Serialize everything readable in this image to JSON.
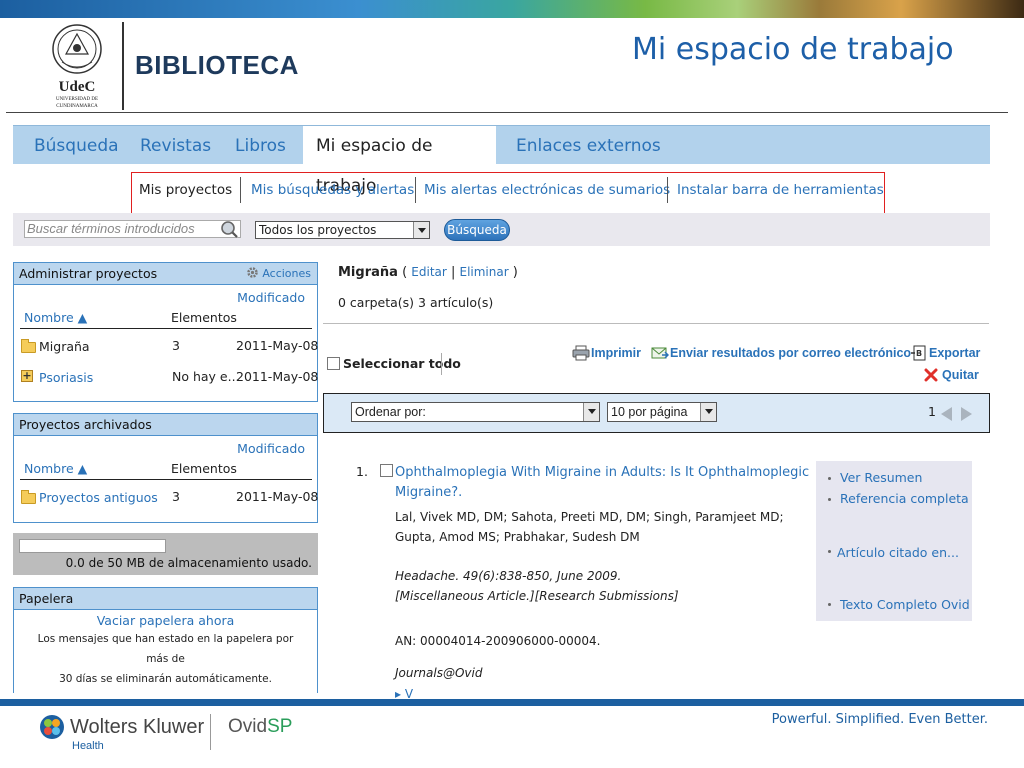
{
  "header": {
    "logo_text": "UdeC",
    "logo_subtext": "UNIVERSIDAD DE CUNDINAMARCA",
    "library_label": "BIBLIOTECA",
    "slide_title": "Mi espacio de trabajo"
  },
  "tabs": [
    {
      "label": "Búsqueda",
      "active": false
    },
    {
      "label": "Revistas",
      "active": false
    },
    {
      "label": "Libros",
      "active": false
    },
    {
      "label": "Mi espacio de trabajo",
      "active": true
    },
    {
      "label": "Enlaces externos",
      "active": false
    }
  ],
  "subnav": [
    {
      "label": "Mis proyectos",
      "active": true
    },
    {
      "label": "Mis búsquedas y alertas",
      "active": false
    },
    {
      "label": "Mis alertas electrónicas de sumarios",
      "active": false
    },
    {
      "label": "Instalar barra de herramientas",
      "active": false
    }
  ],
  "search": {
    "placeholder": "Buscar términos introducidos",
    "scope_value": "Todos los proyectos",
    "button_label": "Búsqueda"
  },
  "manage_panel": {
    "title": "Administrar proyectos",
    "actions_label": "Acciones",
    "modified_header": "Modificado",
    "name_header": "Nombre ▲",
    "items_header": "Elementos",
    "rows": [
      {
        "name": "Migraña",
        "items": "3",
        "modified": "2011-May-08",
        "icon": "folder-icon"
      },
      {
        "name": "Psoriasis",
        "items": "No hay e...",
        "modified": "2011-May-08",
        "icon": "plus-folder-icon"
      }
    ]
  },
  "archived_panel": {
    "title": "Proyectos archivados",
    "modified_header": "Modificado",
    "name_header": "Nombre ▲",
    "items_header": "Elementos",
    "rows": [
      {
        "name": "Proyectos antiguos",
        "items": "3",
        "modified": "2011-May-08",
        "icon": "folder-icon"
      }
    ]
  },
  "storage": {
    "text": "0.0 de 50 MB de almacenamiento usado.",
    "used_fraction": 0.0
  },
  "trash_panel": {
    "title": "Papelera",
    "empty_link": "Vaciar papelera ahora",
    "note_1": "Los mensajes que han estado en la papelera por",
    "note_2": "más de",
    "note_3": "30 días se eliminarán automáticamente."
  },
  "project": {
    "name": "Migraña",
    "open_paren": "(",
    "edit": "Editar",
    "sep": "|",
    "delete": "Eliminar",
    "close_paren": ")",
    "counts": "0 carpeta(s) 3 artículo(s)"
  },
  "toolbar": {
    "select_all": "Seleccionar todo",
    "print": "Imprimir",
    "email": "Enviar resultados por correo electrónico",
    "export": "Exportar",
    "remove": "Quitar"
  },
  "sortbar": {
    "sort_value": "Ordenar por:",
    "per_page_value": "10 por página",
    "page": "1"
  },
  "result": {
    "number": "1.",
    "title": "Ophthalmoplegia With Migraine in Adults: Is It Ophthalmoplegic Migraine?.",
    "authors": "Lal, Vivek MD, DM; Sahota, Preeti MD, DM; Singh, Paramjeet MD; Gupta, Amod MS; Prabhakar, Sudesh DM",
    "citation": "Headache. 49(6):838-850, June 2009.",
    "type": "[Miscellaneous Article.][Research Submissions]",
    "an": "AN: 00004014-200906000-00004.",
    "source": "Journals@Ovid",
    "side_links": [
      "Ver Resumen",
      "Referencia completa",
      "Artículo citado en...",
      "Texto Completo Ovid"
    ]
  },
  "footer": {
    "brand": "Wolters Kluwer",
    "brand_sub": "Health",
    "product_a": "Ovid",
    "product_b": "SP",
    "tagline": "Powerful. Simplified. Even Better."
  },
  "colors": {
    "link": "#2a72b8",
    "tab_bar": "#b2d2ec",
    "panel_head": "#bbd6ee",
    "highlight_border": "#e02020",
    "footer_blue": "#1c5fa0"
  }
}
